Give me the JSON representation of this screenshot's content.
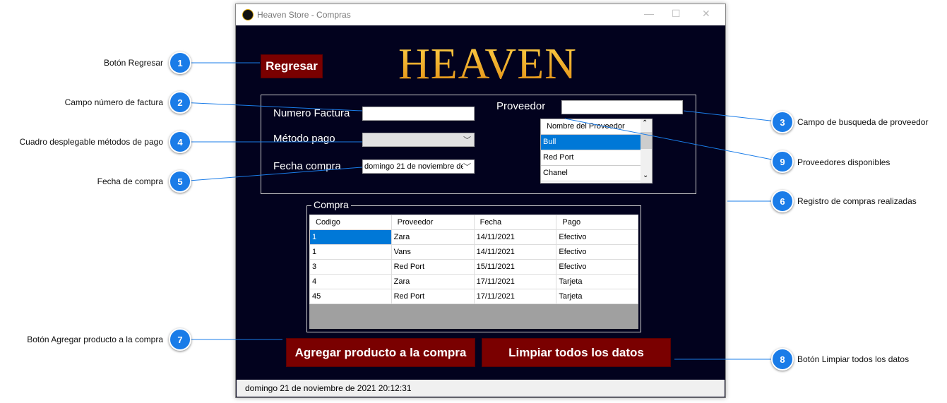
{
  "window": {
    "title": "Heaven Store - Compras",
    "minimize": "—",
    "maximize": "☐",
    "close": "✕"
  },
  "logo": "HEAVEN",
  "buttons": {
    "back": "Regresar",
    "add": "Agregar producto a la compra",
    "clear": "Limpiar todos los datos"
  },
  "form": {
    "invoice_label": "Numero Factura",
    "invoice_value": "",
    "payment_label": "Método pago",
    "payment_value": "",
    "date_label": "Fecha compra",
    "date_value": "domingo  21 de noviembre de",
    "supplier_label": "Proveedor",
    "supplier_search": ""
  },
  "supplier_list": {
    "header": "Nombre del Proveedor",
    "items": [
      "Bull",
      "Red Port",
      "Chanel"
    ],
    "selected": "Bull"
  },
  "purchases": {
    "group_title": "Compra",
    "columns": [
      "Codigo",
      "Proveedor",
      "Fecha",
      "Pago"
    ],
    "rows": [
      [
        "1",
        "Zara",
        "14/11/2021",
        "Efectivo"
      ],
      [
        "1",
        "Vans",
        "14/11/2021",
        "Efectivo"
      ],
      [
        "3",
        "Red Port",
        "15/11/2021",
        "Efectivo"
      ],
      [
        "4",
        "Zara",
        "17/11/2021",
        "Tarjeta"
      ],
      [
        "45",
        "Red Port",
        "17/11/2021",
        "Tarjeta"
      ]
    ]
  },
  "status_bar": "domingo 21 de noviembre de 2021   20:12:31",
  "callouts": [
    {
      "n": "1",
      "label": "Botón Regresar"
    },
    {
      "n": "2",
      "label": "Campo número de factura"
    },
    {
      "n": "3",
      "label": "Campo de busqueda de proveedor"
    },
    {
      "n": "4",
      "label": "Cuadro desplegable métodos de pago"
    },
    {
      "n": "5",
      "label": "Fecha de compra"
    },
    {
      "n": "6",
      "label": "Registro de compras realizadas"
    },
    {
      "n": "7",
      "label": "Botón Agregar producto a la compra"
    },
    {
      "n": "8",
      "label": "Botón Limpiar todos los datos"
    },
    {
      "n": "9",
      "label": "Proveedores disponibles"
    }
  ],
  "colors": {
    "accent": "#1a7ce8",
    "button": "#7a0000",
    "background": "#02021e"
  }
}
